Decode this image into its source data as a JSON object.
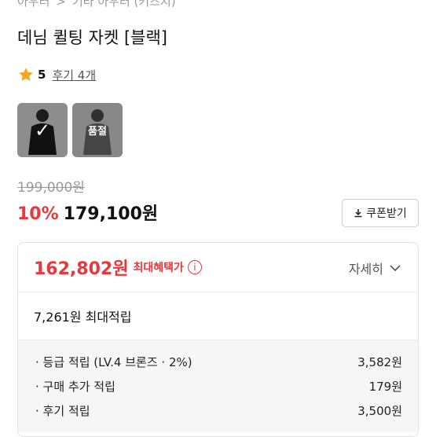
{
  "breadcrumb": {
    "items": [
      "아우터",
      "기타 아우터 (키즈지)"
    ],
    "separator": ">"
  },
  "product": {
    "title": "데님 퀼팅 자켓 [블랙]"
  },
  "rating": {
    "score": "5",
    "reviews_label": "후기 4개"
  },
  "options": [
    {
      "name": "black",
      "selected": true,
      "label": ""
    },
    {
      "name": "other",
      "selected": false,
      "label": "품절"
    }
  ],
  "price": {
    "original": "199,000원",
    "discount": "10%",
    "sale": "179,100원"
  },
  "coupon": {
    "label": "쿠폰받기"
  },
  "benefit": {
    "best_price": "162,802원",
    "best_label": "최대혜택가",
    "detail_label": "자세히",
    "max_points": "7,261원 최대적립",
    "rows": [
      {
        "label": "· 등급 적립 (LV.4 브론즈 · 2%)",
        "value": "3,582원"
      },
      {
        "label": "· 구매 추가 적립",
        "value": "179원"
      },
      {
        "label": "· 후기 적립",
        "value": "3,500원"
      }
    ]
  },
  "colors": {
    "accent_red": "#e8383d",
    "star": "#f5a623"
  }
}
